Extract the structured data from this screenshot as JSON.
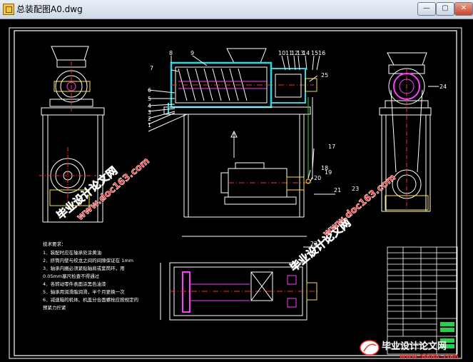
{
  "window": {
    "title": "总装配图A0.dwg",
    "controls": {
      "minimize": "—",
      "maximize": "▢",
      "close": "✕"
    }
  },
  "drawing": {
    "part_labels": [
      "8",
      "9",
      "10",
      "11",
      "12",
      "13",
      "14",
      "15",
      "16",
      "7",
      "6",
      "5",
      "4",
      "3",
      "2",
      "1",
      "25",
      "24",
      "17",
      "18",
      "19",
      "20",
      "21",
      "22",
      "23"
    ],
    "tech_requirements": {
      "heading": "技术要求：",
      "items": [
        "1．装配时应在轴承处涂黄油",
        "2．挤筒内壁与绞龙之间的间隙保证在 1mm",
        "3．轴承内圈必须紧贴轴肩或套筒环，用",
        "0.05mm塞尺检查不得通过",
        "4．各转动零件表面涂黑色油漆",
        "5．轴承用润滑脂润滑，半个月更换一次",
        "6．减速箱的机体、机盖分合面螺栓应按规定的",
        "预紧力拧紧"
      ]
    },
    "watermarks": {
      "site_name": "毕业设计论文网",
      "url": "www.doc163.com",
      "footer_url": "www.56doc.com"
    }
  },
  "colors": {
    "background": "#000000",
    "line_white": "#ffffff",
    "line_red": "#ff2a2a",
    "line_cyan": "#29d6e6",
    "line_magenta": "#ff3cff",
    "line_yellow": "#ffe23a",
    "line_green": "#26d04a",
    "watermark": "#ff2a2a"
  }
}
